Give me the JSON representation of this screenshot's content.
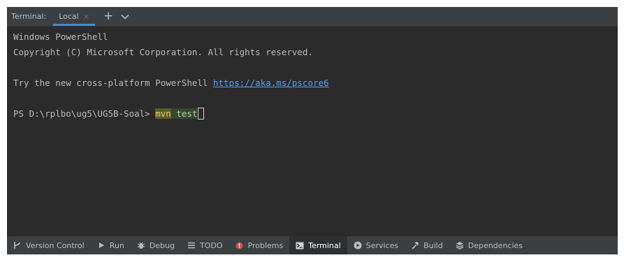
{
  "tabbar": {
    "title": "Terminal:",
    "tabs": [
      {
        "label": "Local",
        "close": "×"
      }
    ],
    "add": "+"
  },
  "terminal": {
    "lines": [
      "Windows PowerShell",
      "Copyright (C) Microsoft Corporation. All rights reserved.",
      "",
      "Try the new cross-platform PowerShell ",
      "",
      "PS D:\\rplbo\\ug5\\UG5B-Soal> "
    ],
    "link": "https://aka.ms/pscore6",
    "command_word1": "mvn",
    "command_space": " ",
    "command_word2": "test"
  },
  "bottombar": {
    "items": [
      {
        "label": "Version Control",
        "icon": "version-control-icon"
      },
      {
        "label": "Run",
        "icon": "run-icon"
      },
      {
        "label": "Debug",
        "icon": "debug-icon"
      },
      {
        "label": "TODO",
        "icon": "todo-icon"
      },
      {
        "label": "Problems",
        "icon": "problems-icon"
      },
      {
        "label": "Terminal",
        "icon": "terminal-icon",
        "active": true
      },
      {
        "label": "Services",
        "icon": "services-icon"
      },
      {
        "label": "Build",
        "icon": "build-icon"
      },
      {
        "label": "Dependencies",
        "icon": "dependencies-icon"
      }
    ]
  },
  "colors": {
    "background": "#2b2b2b",
    "bar": "#3c3f41",
    "text": "#bbbbbb",
    "link": "#589df6",
    "accent": "#4a88c7",
    "problems_icon": "#c75450"
  }
}
